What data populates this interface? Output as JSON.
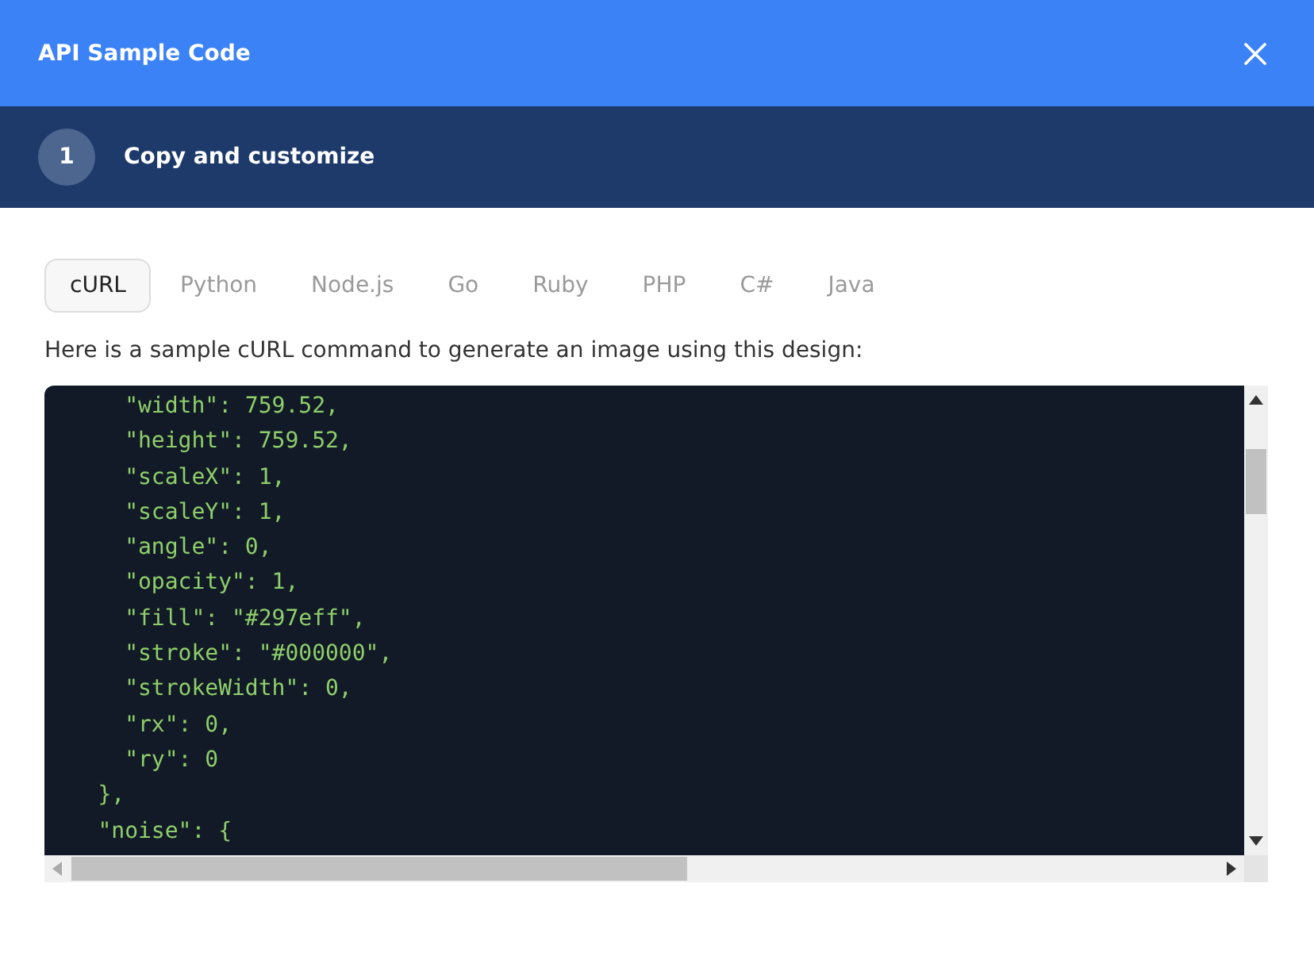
{
  "dialog": {
    "title": "API Sample Code"
  },
  "step": {
    "number": "1",
    "title": "Copy and customize"
  },
  "tabs": [
    {
      "label": "cURL",
      "selected": true
    },
    {
      "label": "Python",
      "selected": false
    },
    {
      "label": "Node.js",
      "selected": false
    },
    {
      "label": "Go",
      "selected": false
    },
    {
      "label": "Ruby",
      "selected": false
    },
    {
      "label": "PHP",
      "selected": false
    },
    {
      "label": "C#",
      "selected": false
    },
    {
      "label": "Java",
      "selected": false
    }
  ],
  "description": "Here is a sample cURL command to generate an image using this design:",
  "code_lines": [
    "      \"width\": 759.52,",
    "      \"height\": 759.52,",
    "      \"scaleX\": 1,",
    "      \"scaleY\": 1,",
    "      \"angle\": 0,",
    "      \"opacity\": 1,",
    "      \"fill\": \"#297eff\",",
    "      \"stroke\": \"#000000\",",
    "      \"strokeWidth\": 0,",
    "      \"rx\": 0,",
    "      \"ry\": 0",
    "    },",
    "    \"noise\": {"
  ]
}
